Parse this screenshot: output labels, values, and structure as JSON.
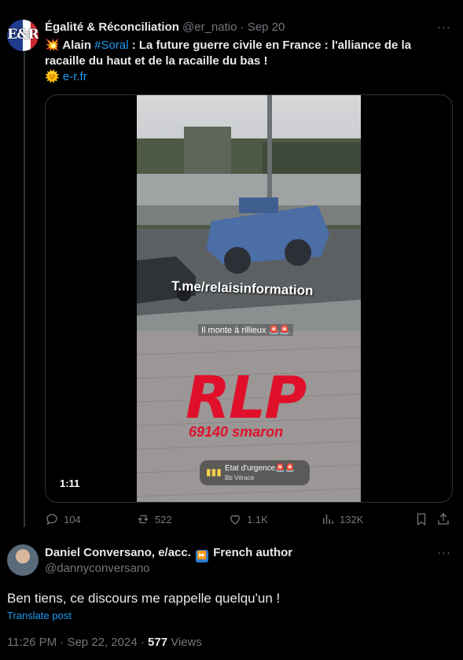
{
  "tweet": {
    "author_name": "Égalité & Réconciliation",
    "handle": "@er_natio",
    "separator": "·",
    "date": "Sep 20",
    "avatar_text": "E&R",
    "more": "···",
    "text_prefix": "Alain",
    "hashtag": "#Soral",
    "text_rest": ": La future guerre civile en France : l'alliance de la racaille du haut et de la racaille du bas !",
    "link": "e-r.fr",
    "video": {
      "duration": "1:11",
      "watermark": "T.me/relaisinformation",
      "caption": "Il monte à rillieux",
      "overlay_title": "RLP",
      "overlay_subtitle": "69140 smaron",
      "pill_title": "Etat d'urgence",
      "pill_sub": "Bb Vérace"
    },
    "stats": {
      "replies": "104",
      "reposts": "522",
      "likes": "1.1K",
      "views": "132K"
    }
  },
  "reply": {
    "author_name": "Daniel Conversano, e/acc.",
    "author_suffix": "French author",
    "handle": "@dannyconversano",
    "more": "···",
    "text": "Ben tiens, ce discours me rappelle quelqu'un !",
    "translate": "Translate post",
    "time": "11:26 PM",
    "separator": "·",
    "date": "Sep 22, 2024",
    "separator2": "·",
    "views_count": "577",
    "views_label": "Views"
  },
  "colors": {
    "background": "#000000",
    "text": "#e7e9ea",
    "muted": "#71767b",
    "accent": "#1d9bf0",
    "rlp_red": "#e0102a"
  }
}
